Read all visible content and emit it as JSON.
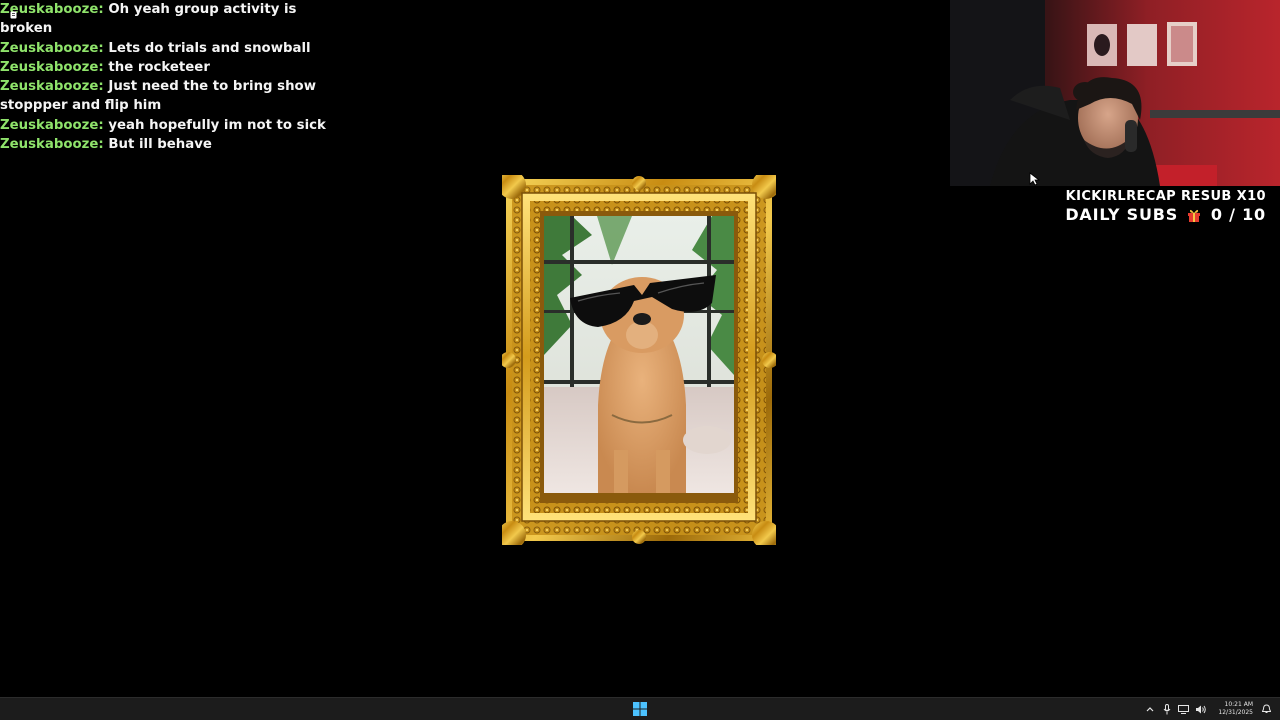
{
  "chat": {
    "messages": [
      {
        "user": "Zeuskabooze",
        "text": "Oh yeah group activity is broken"
      },
      {
        "user": "Zeuskabooze",
        "text": "Lets do trials and snowball"
      },
      {
        "user": "Zeuskabooze",
        "text": "the rocketeer"
      },
      {
        "user": "Zeuskabooze",
        "text": "Just need the to bring show stoppper and flip him"
      },
      {
        "user": "Zeuskabooze",
        "text": "yeah hopefully im not to sick"
      },
      {
        "user": "Zeuskabooze",
        "text": "But ill behave"
      }
    ],
    "separator": ":",
    "username_color": "#8fe36b"
  },
  "framed_picture": {
    "frame_color": "#d4a21e",
    "subject_icon": "dog-with-sunglasses-photo"
  },
  "webcam": {
    "icon": "webcam-streamer-feed"
  },
  "sub_goal": {
    "line1": "KICKIRLRECAP RESUB X10",
    "label": "DAILY SUBS",
    "progress": "0 / 10",
    "current": 0,
    "target": 10,
    "gift_icon": "gift-icon"
  },
  "taskbar": {
    "start_icon": "windows-logo-icon",
    "tray_icons": [
      "chevron-up-icon",
      "microphone-icon",
      "display-icon",
      "volume-icon"
    ],
    "time": "10:21 AM",
    "date": "12/31/2025",
    "notification_icon": "notification-bell-icon"
  },
  "colors": {
    "background": "#000000",
    "taskbar": "#1c1c1c",
    "accent_green": "#8fe36b",
    "frame_gold": "#d4a21e"
  }
}
